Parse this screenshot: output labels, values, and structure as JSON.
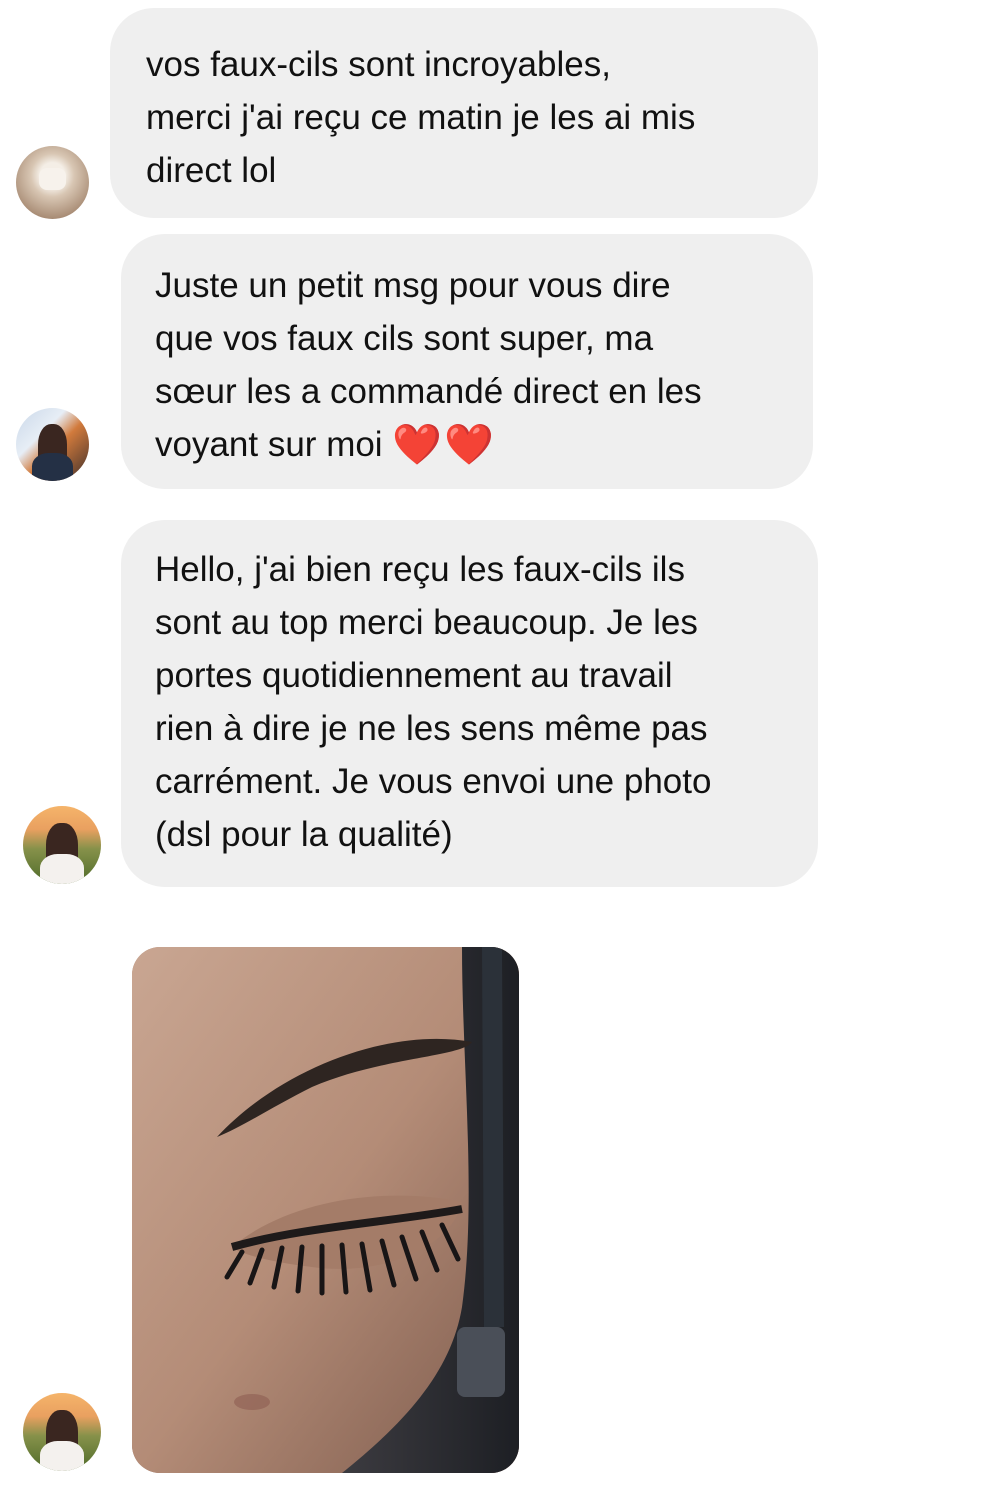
{
  "messages": [
    {
      "text": "vos faux-cils sont incroyables,\nmerci j'ai reçu ce matin je les ai mis\ndirect lol",
      "emoji": ""
    },
    {
      "text": "Juste un petit msg pour vous dire\nque vos faux cils sont super, ma\nsœur les a commandé direct en les\nvoyant sur moi ",
      "emoji": "❤️❤️"
    },
    {
      "text": "Hello, j'ai bien reçu les faux-cils ils\nsont au top merci beaucoup. Je les\nportes quotidiennement au travail\nrien à dire je ne les sens même pas\ncarrément. Je vous envoi une photo\n(dsl pour la qualité)",
      "emoji": ""
    }
  ],
  "colors": {
    "bubble": "#efefef",
    "text": "#111111",
    "heart": "#e5202e"
  }
}
